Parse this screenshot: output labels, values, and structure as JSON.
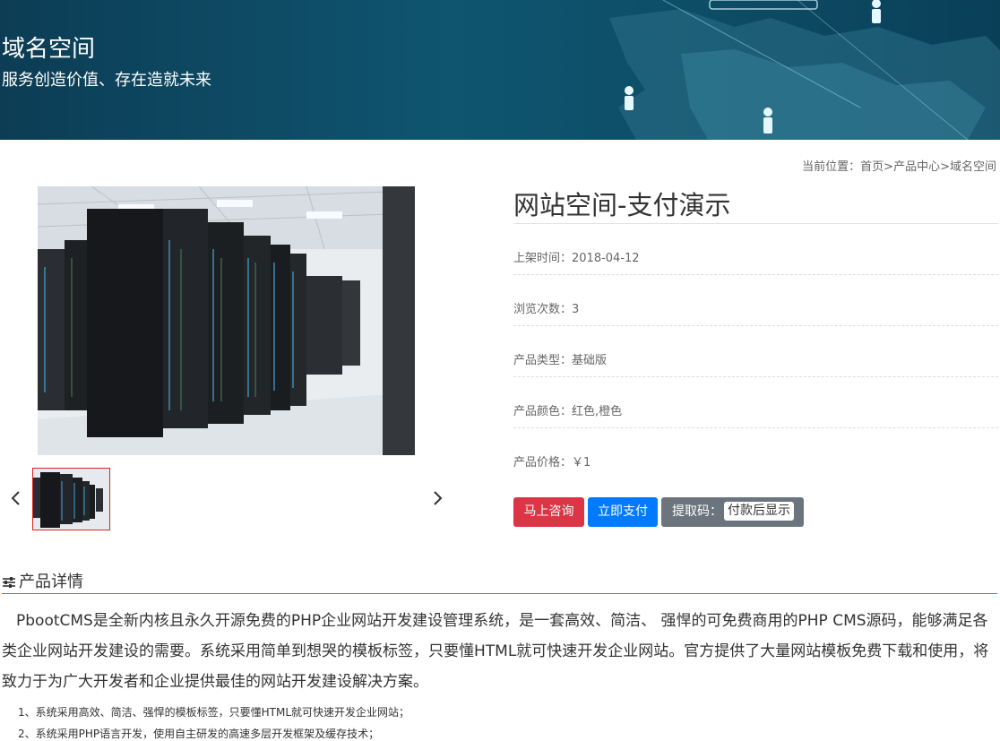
{
  "banner": {
    "title": "域名空间",
    "subtitle": "服务创造价值、存在造就未来"
  },
  "breadcrumb": {
    "prefix": "当前位置：",
    "items": [
      "首页",
      "产品中心",
      "域名空间"
    ],
    "separator": ">"
  },
  "product": {
    "title": "网站空间-支付演示",
    "fields": [
      {
        "label": "上架时间：",
        "value": "2018-04-12"
      },
      {
        "label": "浏览次数：",
        "value": "3"
      },
      {
        "label": "产品类型：",
        "value": "基础版"
      },
      {
        "label": "产品颜色：",
        "value": "红色,橙色"
      },
      {
        "label": "产品价格：",
        "value": "￥1"
      }
    ],
    "buttons": {
      "consult": "马上咨询",
      "pay": "立即支付",
      "code_label": "提取码：",
      "code_value": "付款后显示"
    }
  },
  "gallery": {
    "main_image": "server-room-image",
    "thumbnail": "server-room-thumbnail",
    "prev_icon": "chevron-left-icon",
    "next_icon": "chevron-right-icon"
  },
  "details": {
    "heading": "产品详情",
    "heading_icon": "sliders-icon",
    "paragraph": "PbootCMS是全新内核且永久开源免费的PHP企业网站开发建设管理系统，是一套高效、简洁、 强悍的可免费商用的PHP CMS源码，能够满足各类企业网站开发建设的需要。系统采用简单到想哭的模板标签，只要懂HTML就可快速开发企业网站。官方提供了大量网站模板免费下载和使用，将致力于为广大开发者和企业提供最佳的网站开发建设解决方案。",
    "list": [
      "1、系统采用高效、简洁、强悍的模板标签，只要懂HTML就可快速开发企业网站；",
      "2、系统采用PHP语言开发，使用自主研发的高速多层开发框架及缓存技术；"
    ]
  },
  "colors": {
    "banner_bg": "#0f5570",
    "consult_btn": "#dc3545",
    "pay_btn": "#007bff",
    "code_btn": "#6c757d",
    "details_rule": "#2a8fbd",
    "thumb_active_border": "#d9251f"
  }
}
